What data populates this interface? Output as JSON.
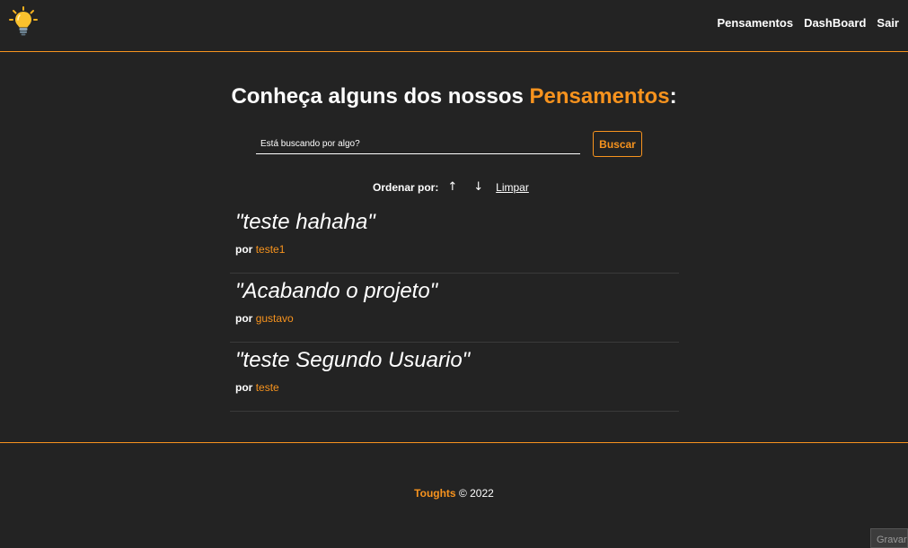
{
  "nav": {
    "logo_icon": "lightbulb-icon",
    "links": [
      "Pensamentos",
      "DashBoard",
      "Sair"
    ]
  },
  "main": {
    "title_prefix": "Conheça alguns dos nossos ",
    "title_accent": "Pensamentos",
    "title_suffix": ":",
    "search": {
      "placeholder": "Está buscando por algo?",
      "button_label": "Buscar"
    },
    "order": {
      "label": "Ordenar por:",
      "asc_arrow": "↑",
      "desc_arrow": "↓",
      "clear_label": "Limpar"
    },
    "by_label": "por",
    "thoughts": [
      {
        "text": "\"teste hahaha\"",
        "author": "teste1"
      },
      {
        "text": "\"Acabando o projeto\"",
        "author": "gustavo"
      },
      {
        "text": "\"teste Segundo Usuario\"",
        "author": "teste"
      }
    ]
  },
  "footer": {
    "brand": "Toughts",
    "copyright": " © 2022"
  },
  "widget": {
    "label": "Gravar"
  },
  "colors": {
    "background": "#232323",
    "accent": "#f7931e",
    "text": "#ffffff"
  }
}
